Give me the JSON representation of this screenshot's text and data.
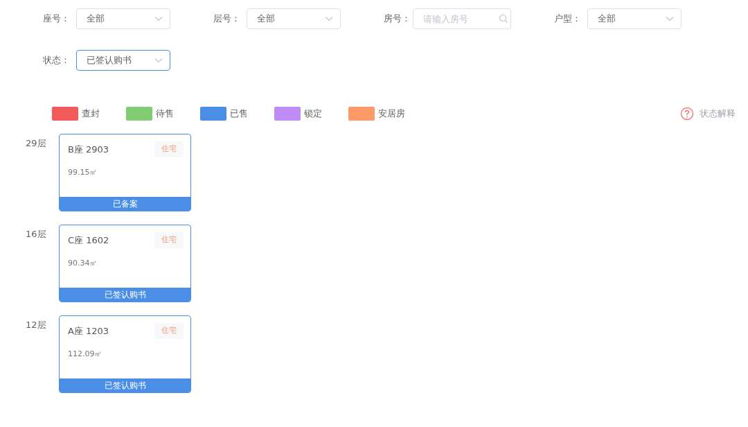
{
  "filters": [
    {
      "kind": "select",
      "label": "座号：",
      "value": "全部",
      "focused": false
    },
    {
      "kind": "select",
      "label": "层号：",
      "value": "全部",
      "focused": false
    },
    {
      "kind": "search",
      "label": "房号：",
      "placeholder": "请输入房号",
      "focused": false
    },
    {
      "kind": "select",
      "label": "户型：",
      "value": "全部",
      "focused": false
    },
    {
      "kind": "select",
      "label": "状态：",
      "value": "已签认购书",
      "focused": true
    }
  ],
  "legend": [
    {
      "label": "查封",
      "color": "#f05a5a"
    },
    {
      "label": "待售",
      "color": "#82cc74"
    },
    {
      "label": "已售",
      "color": "#4a8ee6"
    },
    {
      "label": "锁定",
      "color": "#bf8cf5"
    },
    {
      "label": "安居房",
      "color": "#fd9a68"
    }
  ],
  "help_link": "状态解释",
  "floors": [
    {
      "floor": "29层",
      "units": [
        {
          "name": "B座 2903",
          "tag": "住宅",
          "area": "99.15㎡",
          "status": "已备案",
          "color": "#4a8ee6"
        }
      ]
    },
    {
      "floor": "16层",
      "units": [
        {
          "name": "C座 1602",
          "tag": "住宅",
          "area": "90.34㎡",
          "status": "已签认购书",
          "color": "#4a8ee6"
        }
      ]
    },
    {
      "floor": "12层",
      "units": [
        {
          "name": "A座 1203",
          "tag": "住宅",
          "area": "112.09㎡",
          "status": "已签认购书",
          "color": "#4a8ee6"
        }
      ]
    }
  ]
}
